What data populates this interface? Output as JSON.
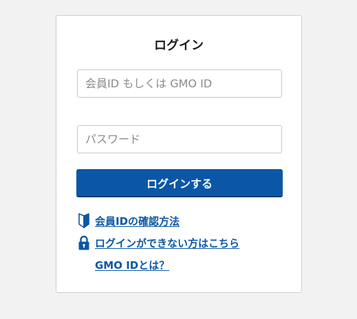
{
  "login": {
    "title": "ログイン",
    "member_id_placeholder": "会員ID もしくは GMO ID",
    "password_placeholder": "パスワード",
    "submit_label": "ログインする"
  },
  "links": [
    {
      "label": "会員IDの確認方法",
      "icon": "beginner-mark-icon"
    },
    {
      "label": "ログインができない方はこちら",
      "icon": "lock-icon"
    },
    {
      "label": "GMO IDとは？",
      "icon": ""
    }
  ],
  "colors": {
    "accent": "#0b57a6",
    "background": "#f2f2f2",
    "card": "#ffffff"
  }
}
